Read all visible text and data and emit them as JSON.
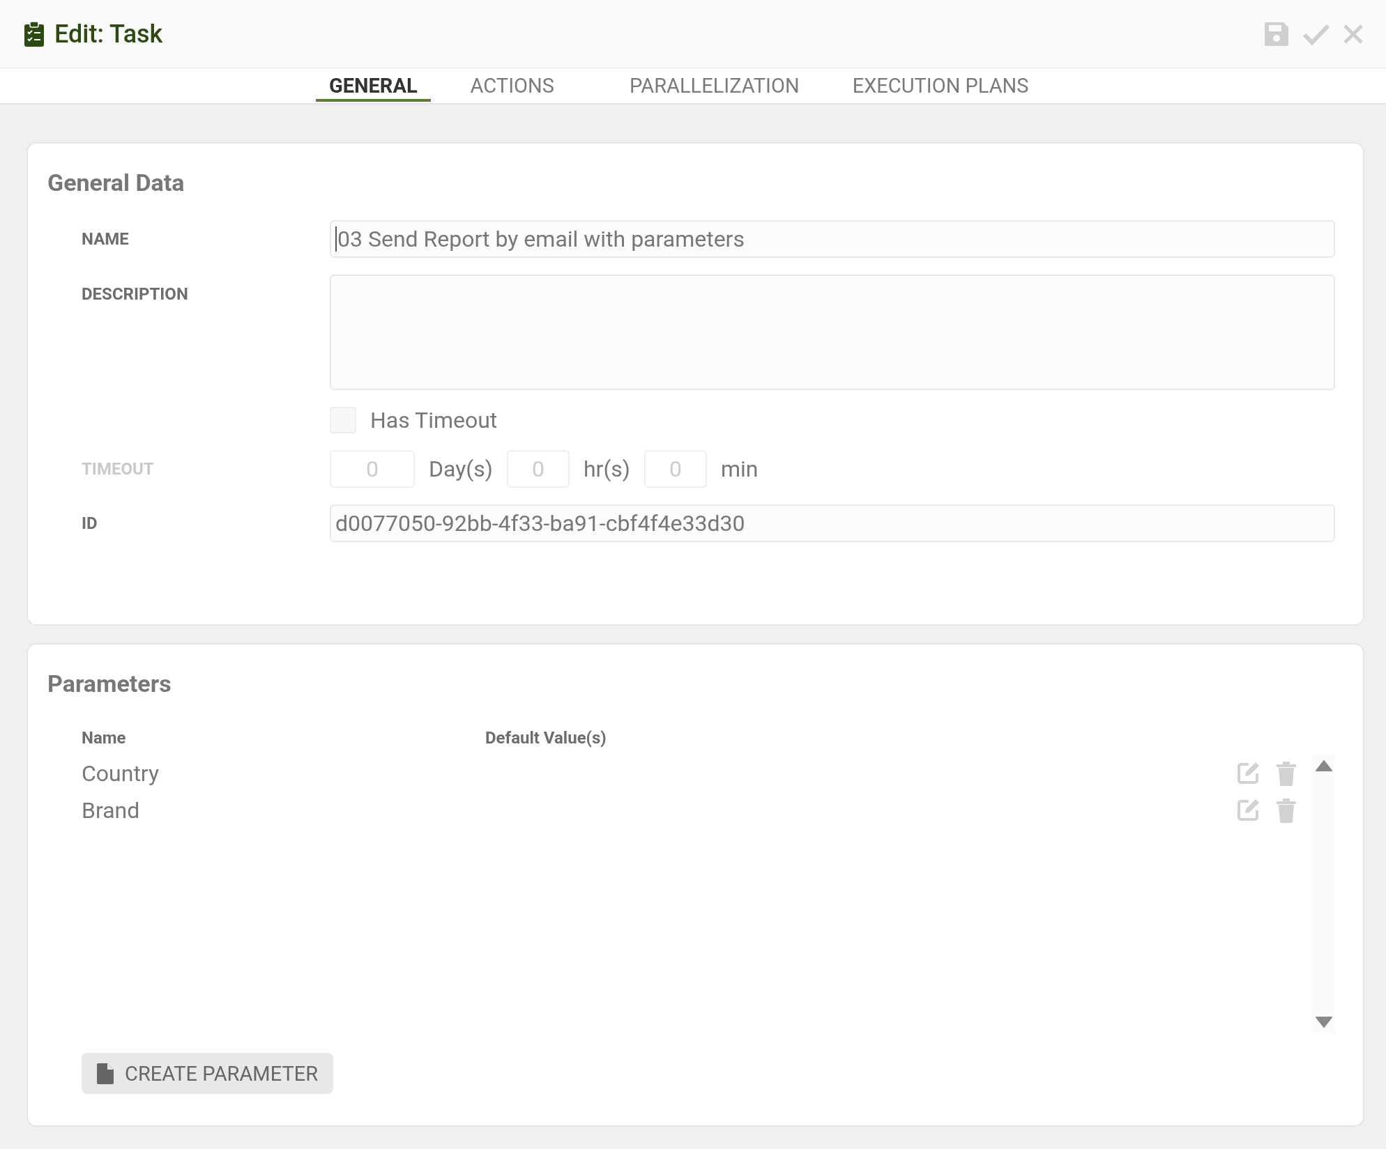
{
  "header": {
    "title": "Edit: Task"
  },
  "tabs": [
    {
      "label": "GENERAL",
      "selected": true
    },
    {
      "label": "ACTIONS",
      "selected": false
    },
    {
      "label": "PARALLELIZATION",
      "selected": false
    },
    {
      "label": "EXECUTION PLANS",
      "selected": false
    }
  ],
  "general_data": {
    "heading": "General Data",
    "name": {
      "label": "NAME",
      "value": "03 Send Report by email with parameters"
    },
    "description": {
      "label": "DESCRIPTION"
    },
    "has_timeout": {
      "label": "Has Timeout",
      "checked": false
    },
    "timeout": {
      "label": "TIMEOUT",
      "disabled": true,
      "days": "0",
      "days_unit": "Day(s)",
      "hours": "0",
      "hours_unit": "hr(s)",
      "minutes": "0",
      "minutes_unit": "min"
    },
    "id": {
      "label": "ID",
      "value": "d0077050-92bb-4f33-ba91-cbf4f4e33d30"
    }
  },
  "parameters": {
    "heading": "Parameters",
    "columns": [
      "Name",
      "Default Value(s)"
    ],
    "rows": [
      {
        "name": "Country"
      },
      {
        "name": "Brand"
      }
    ],
    "create_button": "CREATE PARAMETER"
  }
}
